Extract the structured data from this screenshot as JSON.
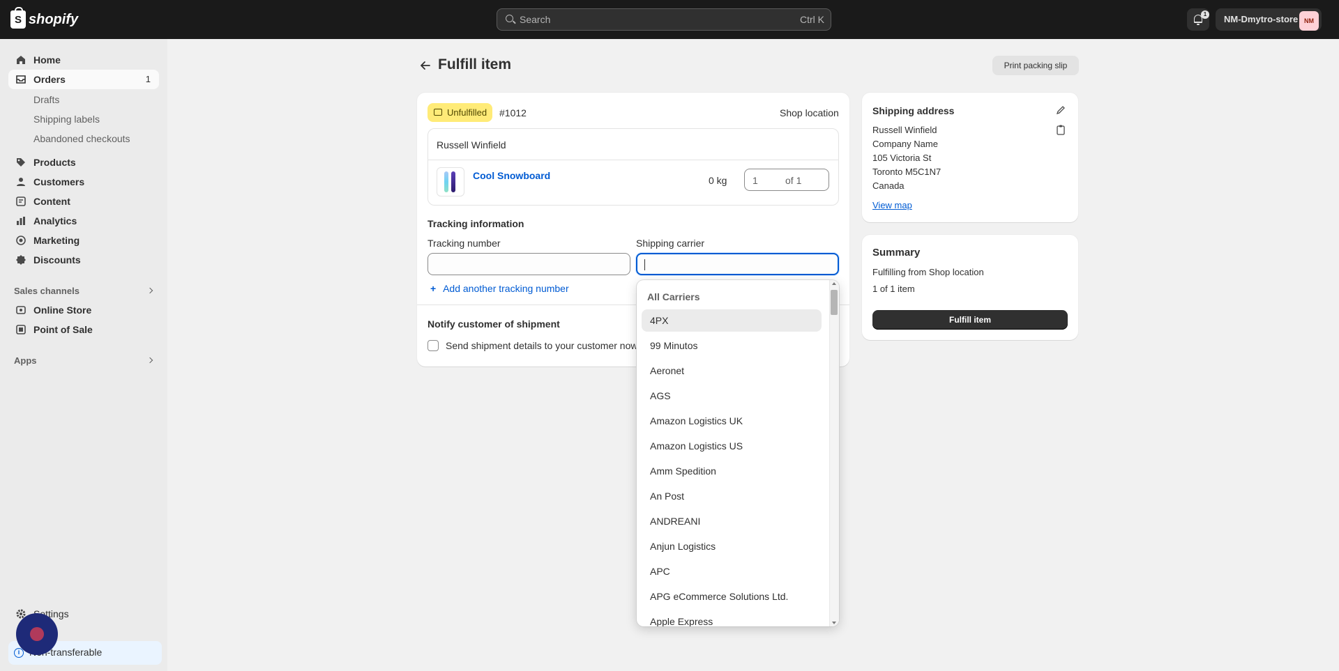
{
  "topbar": {
    "logo_text": "shopify",
    "logo_glyph": "S",
    "search_placeholder": "Search",
    "search_shortcut": "Ctrl K",
    "notifications_count": "1",
    "store_name": "NM-Dmytro-store",
    "store_avatar": "NM"
  },
  "sidebar": {
    "items": [
      {
        "label": "Home",
        "icon": "home-icon"
      },
      {
        "label": "Orders",
        "icon": "orders-icon",
        "count": "1"
      },
      {
        "label": "Products",
        "icon": "tag-icon"
      },
      {
        "label": "Customers",
        "icon": "person-icon"
      },
      {
        "label": "Content",
        "icon": "content-icon"
      },
      {
        "label": "Analytics",
        "icon": "bar-chart-icon"
      },
      {
        "label": "Marketing",
        "icon": "target-icon"
      },
      {
        "label": "Discounts",
        "icon": "discount-icon"
      }
    ],
    "orders_sub": [
      "Drafts",
      "Shipping labels",
      "Abandoned checkouts"
    ],
    "sales_channels_label": "Sales channels",
    "channels": [
      {
        "label": "Online Store",
        "icon": "store-icon"
      },
      {
        "label": "Point of Sale",
        "icon": "pos-icon"
      }
    ],
    "apps_label": "Apps",
    "settings_label": "Settings",
    "nontransferable_label": "Non-transferable"
  },
  "page": {
    "title": "Fulfill item",
    "print_button": "Print packing slip"
  },
  "fulfillment": {
    "status_badge": "Unfulfilled",
    "order_number": "#1012",
    "location": "Shop location",
    "customer": "Russell Winfield",
    "product_name": "Cool Snowboard",
    "weight": "0 kg",
    "quantity_value": "1",
    "quantity_of": "of 1"
  },
  "tracking": {
    "section_title": "Tracking information",
    "number_label": "Tracking number",
    "carrier_label": "Shipping carrier",
    "add_another": "Add another tracking number"
  },
  "notify": {
    "section_title": "Notify customer of shipment",
    "checkbox_label": "Send shipment details to your customer now"
  },
  "carrier_dropdown": {
    "header": "All Carriers",
    "options": [
      "4PX",
      "99 Minutos",
      "Aeronet",
      "AGS",
      "Amazon Logistics UK",
      "Amazon Logistics US",
      "Amm Spedition",
      "An Post",
      "ANDREANI",
      "Anjun Logistics",
      "APC",
      "APG eCommerce Solutions Ltd.",
      "Apple Express"
    ],
    "highlighted": "4PX"
  },
  "shipping_address": {
    "title": "Shipping address",
    "lines": [
      "Russell Winfield",
      "Company Name",
      "105 Victoria St",
      "Toronto M5C1N7",
      "Canada"
    ],
    "view_map": "View map"
  },
  "summary": {
    "title": "Summary",
    "fulfilling_from": "Fulfilling from Shop location",
    "item_count": "1 of 1 item",
    "fulfill_button": "Fulfill item"
  },
  "colors": {
    "accent": "#005bd3",
    "badge_warning": "#ffeb78",
    "topbar": "#1a1a1a"
  }
}
